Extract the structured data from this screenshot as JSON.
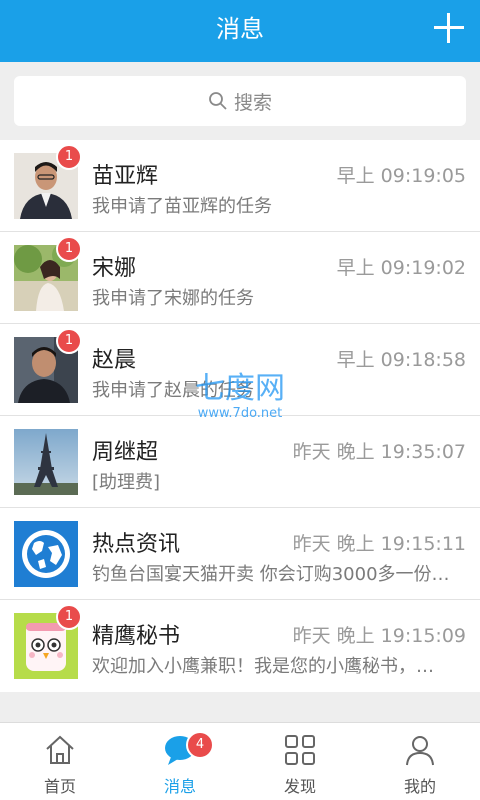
{
  "header": {
    "title": "消息"
  },
  "search": {
    "placeholder": "搜索"
  },
  "messages": [
    {
      "name": "苗亚辉",
      "time": "早上 09:19:05",
      "preview": "我申请了苗亚辉的任务",
      "badge": "1"
    },
    {
      "name": "宋娜",
      "time": "早上 09:19:02",
      "preview": "我申请了宋娜的任务",
      "badge": "1"
    },
    {
      "name": "赵晨",
      "time": "早上 09:18:58",
      "preview": "我申请了赵晨的任务",
      "badge": "1"
    },
    {
      "name": "周继超",
      "time": "昨天  晚上 19:35:07",
      "preview": "[助理费]"
    },
    {
      "name": "热点资讯",
      "time": "昨天  晚上 19:15:11",
      "preview": "钓鱼台国宴天猫开卖 你会订购3000多一份…"
    },
    {
      "name": "精鹰秘书",
      "time": "昨天  晚上 19:15:09",
      "preview": "欢迎加入小鹰兼职！我是您的小鹰秘书，…",
      "badge": "1"
    }
  ],
  "tabs": [
    {
      "label": "首页",
      "icon": "home-icon"
    },
    {
      "label": "消息",
      "icon": "chat-icon",
      "badge": "4",
      "active": true
    },
    {
      "label": "发现",
      "icon": "grid-icon"
    },
    {
      "label": "我的",
      "icon": "person-icon"
    }
  ],
  "watermark": {
    "logo": "七度网",
    "url": "www.7do.net"
  },
  "colors": {
    "primary": "#1aa0e8",
    "badge": "#e94b4b",
    "background": "#eeeeee"
  }
}
